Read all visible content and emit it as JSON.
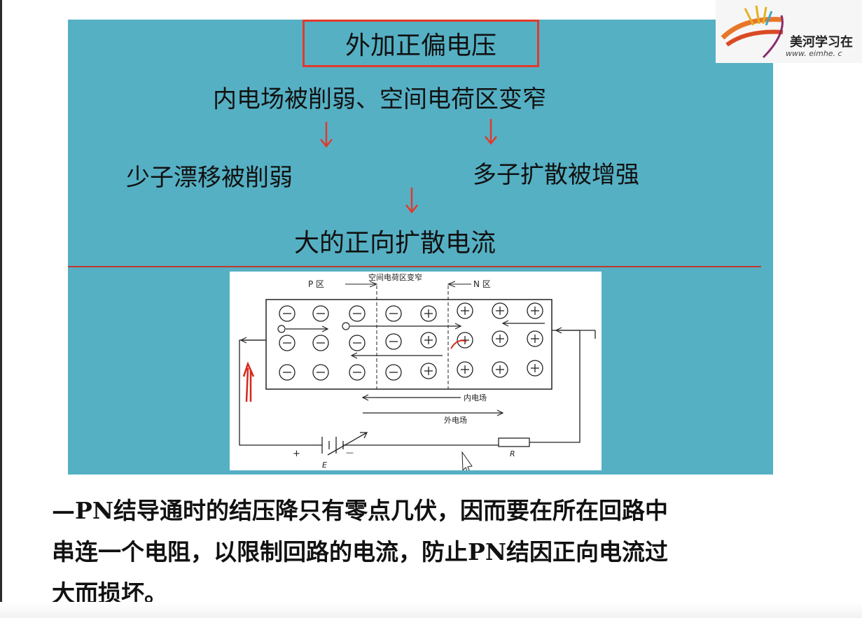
{
  "slide": {
    "title": "外加正偏电压",
    "line1": "内电场被削弱、空间电荷区变窄",
    "line2_left": "少子漂移被削弱",
    "line2_right": "多子扩散被增强",
    "line3": "大的正向扩散电流",
    "accent_red": "#e23a2a",
    "panel_color": "#55b0c4"
  },
  "figure": {
    "label_p": "P 区",
    "label_depletion": "空间电荷区变窄",
    "label_n": "N 区",
    "label_inner_field": "内电场",
    "label_outer_field": "外电场",
    "battery_label": "E",
    "resistor_label": "R",
    "plus_sign": "+",
    "minus_sign": "—"
  },
  "body": {
    "line1": "—PN结导通时的结压降只有零点几伏，因而要在所在回路中",
    "line2": "串连一个电阻，以限制回路的电流，防止PN结因正向电流过",
    "line3": "大而损坏。"
  },
  "logo": {
    "name": "美河学习在",
    "url": "www. eimhe. c"
  }
}
